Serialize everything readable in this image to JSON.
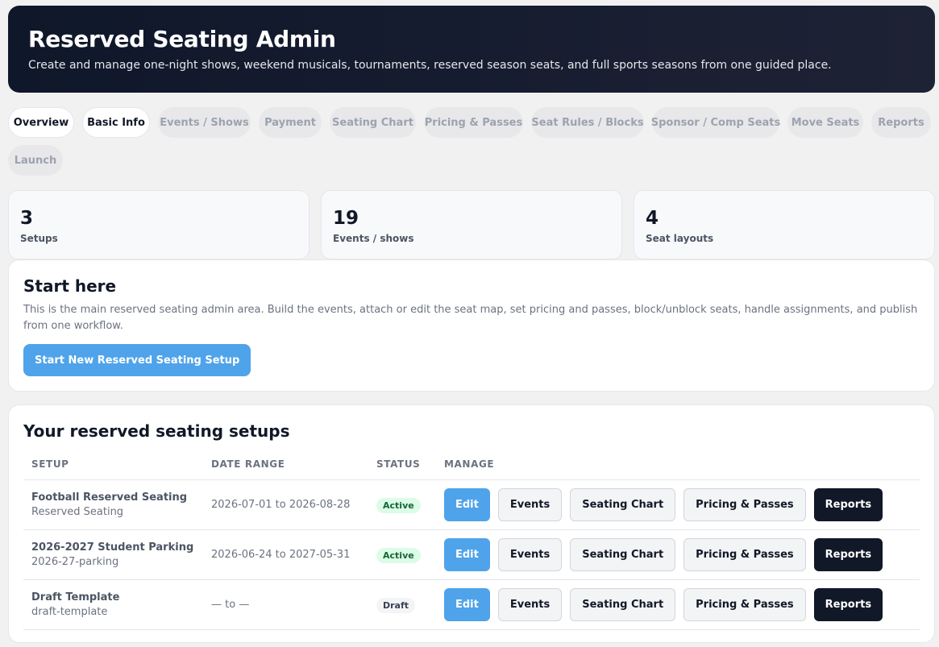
{
  "header": {
    "title": "Reserved Seating Admin",
    "subtitle": "Create and manage one-night shows, weekend musicals, tournaments, reserved season seats, and full sports seasons from one guided place."
  },
  "tabs": [
    {
      "label": "Overview",
      "active": true
    },
    {
      "label": "Basic Info",
      "active": true
    },
    {
      "label": "Events / Shows",
      "active": false
    },
    {
      "label": "Payment",
      "active": false
    },
    {
      "label": "Seating Chart",
      "active": false
    },
    {
      "label": "Pricing & Passes",
      "active": false
    },
    {
      "label": "Seat Rules / Blocks",
      "active": false
    },
    {
      "label": "Sponsor / Comp Seats",
      "active": false
    },
    {
      "label": "Move Seats",
      "active": false
    },
    {
      "label": "Reports",
      "active": false
    },
    {
      "label": "Launch",
      "active": false
    }
  ],
  "stats": [
    {
      "value": "3",
      "label": "Setups"
    },
    {
      "value": "19",
      "label": "Events / shows"
    },
    {
      "value": "4",
      "label": "Seat layouts"
    }
  ],
  "start": {
    "title": "Start here",
    "description": "This is the main reserved seating admin area. Build the events, attach or edit the seat map, set pricing and passes, block/unblock seats, handle assignments, and publish from one workflow.",
    "button": "Start New Reserved Seating Setup"
  },
  "setups": {
    "title": "Your reserved seating setups",
    "columns": [
      "SETUP",
      "DATE RANGE",
      "STATUS",
      "MANAGE"
    ],
    "actions": [
      "Edit",
      "Events",
      "Seating Chart",
      "Pricing & Passes",
      "Reports"
    ],
    "rows": [
      {
        "name": "Football Reserved Seating",
        "slug": "Reserved Seating",
        "range": "2026-07-01 to 2026-08-28",
        "status": "Active"
      },
      {
        "name": "2026-2027 Student Parking",
        "slug": "2026-27-parking",
        "range": "2026-06-24 to 2027-05-31",
        "status": "Active"
      },
      {
        "name": "Draft Template",
        "slug": "draft-template",
        "range": "— to —",
        "status": "Draft"
      }
    ]
  },
  "colors": {
    "accent": "#4fa3ea",
    "dark": "#111827",
    "active_badge": "#dcfce7",
    "draft_badge": "#f3f4f6"
  }
}
